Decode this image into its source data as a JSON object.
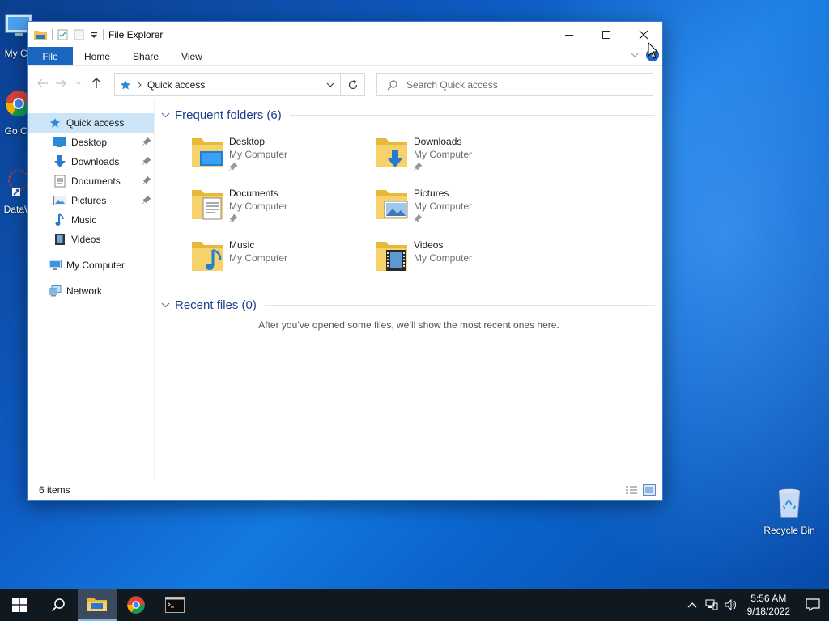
{
  "desktop": {
    "icons": [
      {
        "label": "My Co",
        "icon": "computer-icon"
      },
      {
        "label": "Go Ch",
        "icon": "chrome-shortcut-icon"
      },
      {
        "label": "DataW",
        "icon": "datawrapper-shortcut-icon"
      },
      {
        "label": "Recycle Bin",
        "icon": "recycle-bin-icon"
      }
    ]
  },
  "window": {
    "title": "File Explorer",
    "controls": {
      "minimize": "minimize-icon",
      "maximize": "maximize-icon",
      "close": "close-icon"
    }
  },
  "ribbon": {
    "tabs": [
      "File",
      "Home",
      "Share",
      "View"
    ]
  },
  "navbar": {
    "back": "back-arrow-icon",
    "forward": "forward-arrow-icon",
    "recent": "recent-locations-icon",
    "up": "up-arrow-icon",
    "address": "Quick access",
    "search_placeholder": "Search Quick access"
  },
  "nav_pane": {
    "quick_access": "Quick access",
    "pinned": [
      {
        "label": "Desktop",
        "pinned": true
      },
      {
        "label": "Downloads",
        "pinned": true
      },
      {
        "label": "Documents",
        "pinned": true
      },
      {
        "label": "Pictures",
        "pinned": true
      },
      {
        "label": "Music",
        "pinned": false
      },
      {
        "label": "Videos",
        "pinned": false
      }
    ],
    "my_computer": "My Computer",
    "network": "Network"
  },
  "content": {
    "frequent_title": "Frequent folders (6)",
    "folders": [
      {
        "name": "Desktop",
        "location": "My Computer",
        "pinned": true
      },
      {
        "name": "Downloads",
        "location": "My Computer",
        "pinned": true
      },
      {
        "name": "Documents",
        "location": "My Computer",
        "pinned": true
      },
      {
        "name": "Pictures",
        "location": "My Computer",
        "pinned": true
      },
      {
        "name": "Music",
        "location": "My Computer",
        "pinned": false
      },
      {
        "name": "Videos",
        "location": "My Computer",
        "pinned": false
      }
    ],
    "recent_title": "Recent files (0)",
    "recent_empty": "After you’ve opened some files, we’ll show the most recent ones here."
  },
  "status": {
    "items": "6 items"
  },
  "taskbar": {
    "time": "5:56 AM",
    "date": "9/18/2022"
  },
  "colors": {
    "accent": "#1a66c0",
    "selection": "#cce4f7",
    "group_title": "#1e3f8a",
    "taskbar": "#101820"
  }
}
